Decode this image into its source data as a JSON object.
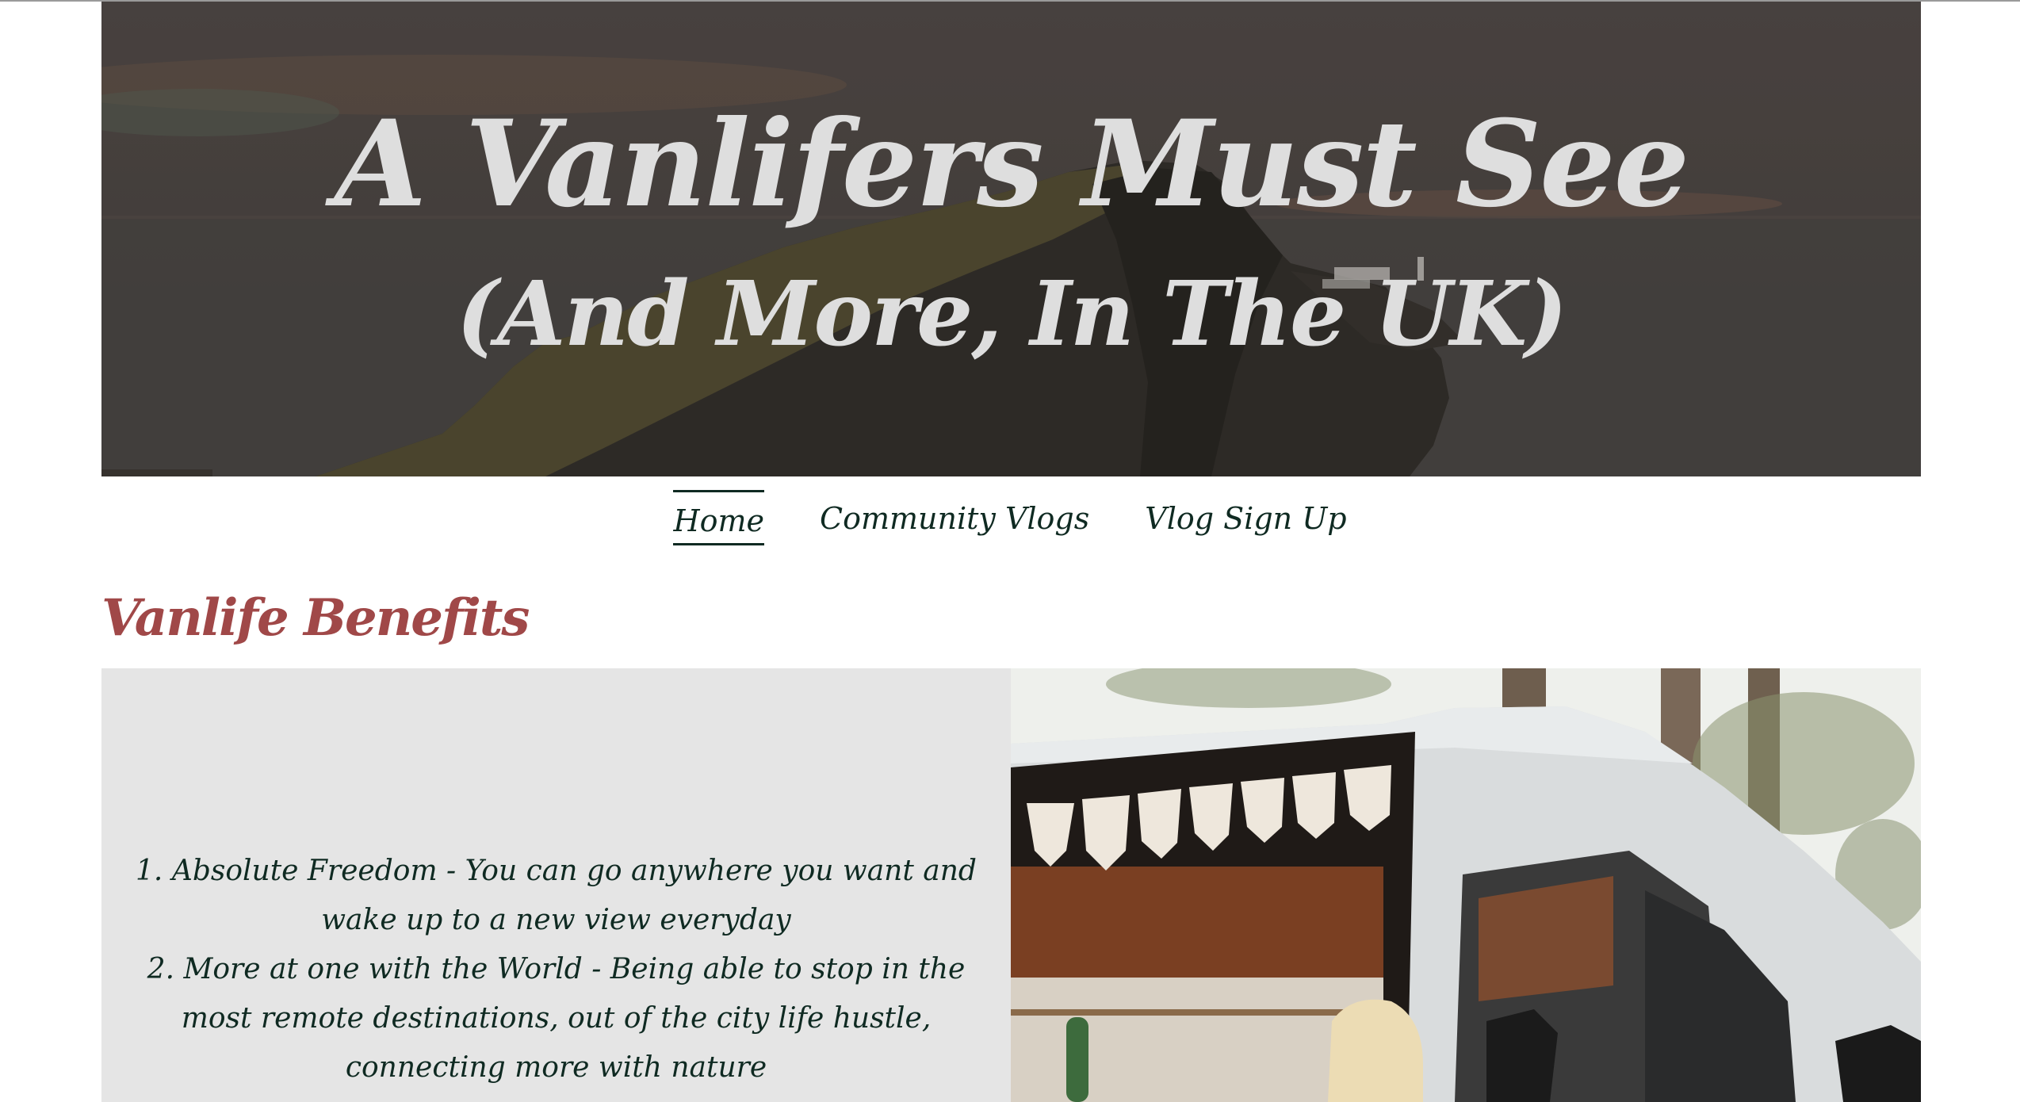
{
  "hero": {
    "title": "A Vanlifers Must See",
    "subtitle": "(And More, In The UK)",
    "background_icon": "coastal-cliff-lighthouse-image"
  },
  "nav": {
    "items": [
      {
        "label": "Home",
        "active": true
      },
      {
        "label": "Community Vlogs",
        "active": false
      },
      {
        "label": "Vlog Sign Up",
        "active": false
      }
    ]
  },
  "section": {
    "title": "Vanlife Benefits"
  },
  "benefits": {
    "items": [
      "1. Absolute Freedom - You can go anywhere you want and wake up to a new view everyday",
      "2. More at one with the World - Being able to stop in the most remote destinations, out of the city life hustle, connecting more with nature"
    ]
  },
  "photo": {
    "icon": "white-campervan-photo"
  },
  "colors": {
    "nav_text": "#0f2a22",
    "section_title": "#a04848",
    "panel_bg": "#e5e5e5",
    "hero_text": "#dedede"
  }
}
